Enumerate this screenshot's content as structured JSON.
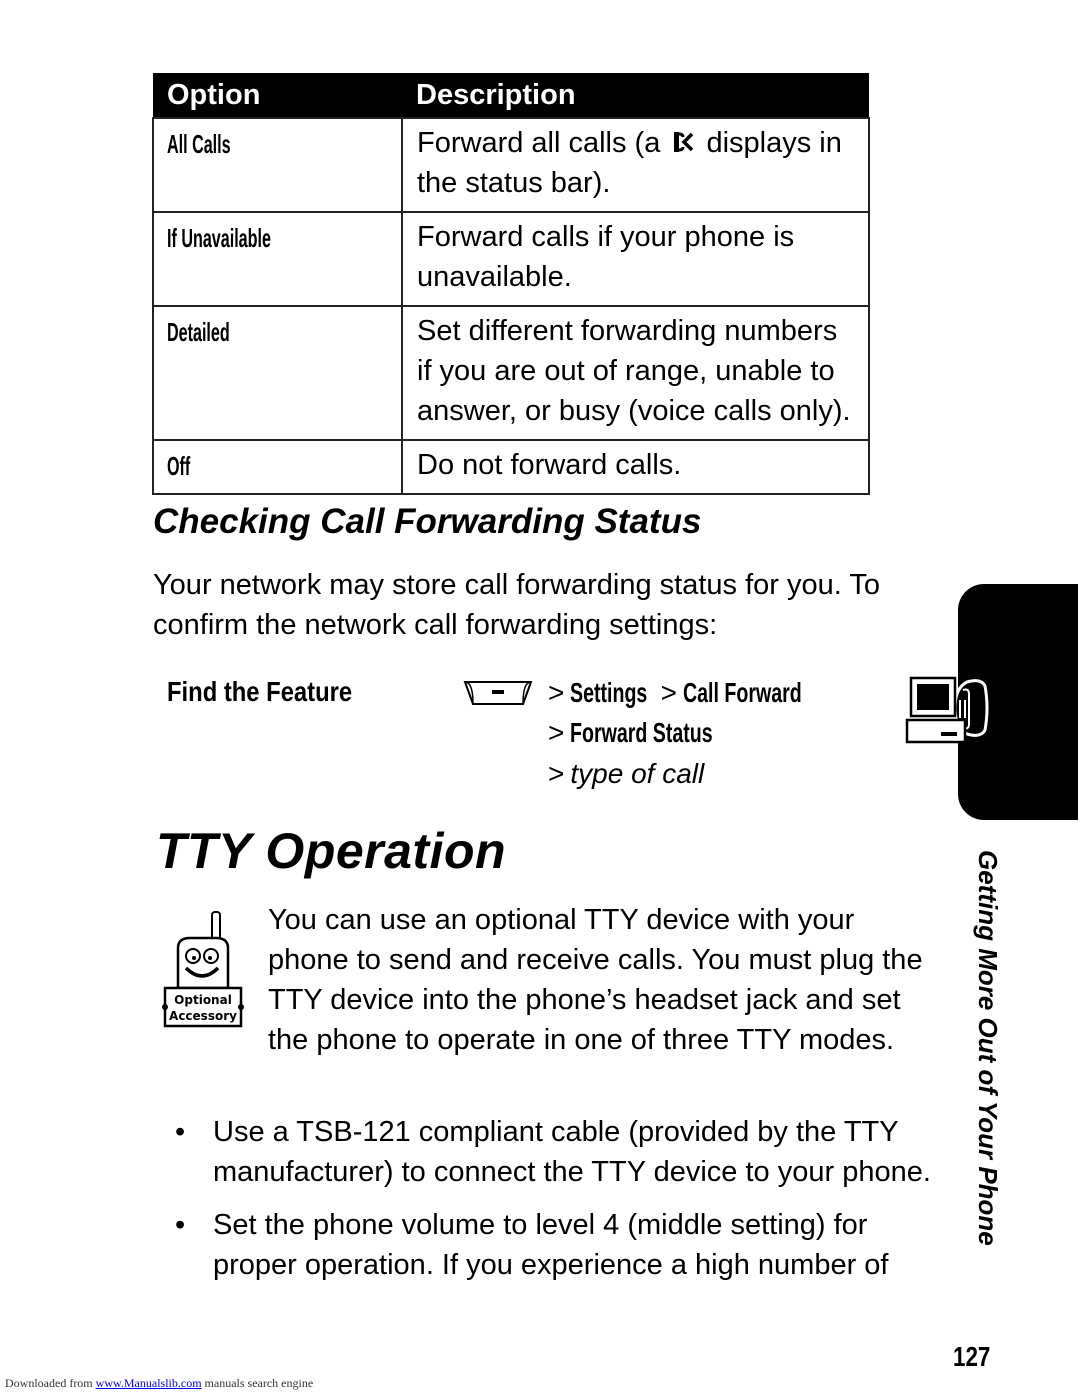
{
  "table": {
    "headers": {
      "option": "Option",
      "description": "Description"
    },
    "rows": [
      {
        "option": "All Calls",
        "description_pre": "Forward all calls (a",
        "description_icon": "call-forward-icon",
        "description_post": "displays in the status bar)."
      },
      {
        "option": "If Unavailable",
        "description": "Forward calls if your phone is unavailable."
      },
      {
        "option": "Detailed",
        "description": "Set different forwarding numbers if you are out of range, unable to answer, or busy (voice calls only)."
      },
      {
        "option": "Off",
        "description": "Do not forward calls."
      }
    ]
  },
  "section": {
    "title": "Checking Call Forwarding Status",
    "paragraph": "Your network may store call forwarding status for you. To confirm the network call forwarding settings:"
  },
  "find_feature": {
    "label": "Find the Feature",
    "key_icon": "menu-key-icon",
    "path": [
      {
        "sep": ">",
        "text": "Settings"
      },
      {
        "sep": ">",
        "text": "Call Forward"
      },
      {
        "sep": ">",
        "text": "Forward Status"
      },
      {
        "sep": ">",
        "text": "type of call"
      }
    ]
  },
  "tty": {
    "title": "TTY Operation",
    "accessory_badge": {
      "line1": "Optional",
      "line2": "Accessory"
    },
    "intro": "You can use an optional TTY device with your phone to send and receive calls. You must plug the TTY device into the phone’s headset jack and set the phone to operate in one of three TTY modes.",
    "bullets": [
      "Use a TSB-121 compliant cable (provided by the TTY manufacturer) to connect the TTY device to your phone.",
      "Set the phone volume to level 4 (middle setting) for proper operation. If you experience a high number of"
    ],
    "bullet_char": "•"
  },
  "side": {
    "chapter_label": "Getting More Out of Your Phone",
    "icon": "tty-device-icon"
  },
  "page_number": "127",
  "footer": {
    "prefix": "Downloaded from",
    "link": "www.Manualslib.com",
    "suffix": "manuals search engine"
  }
}
